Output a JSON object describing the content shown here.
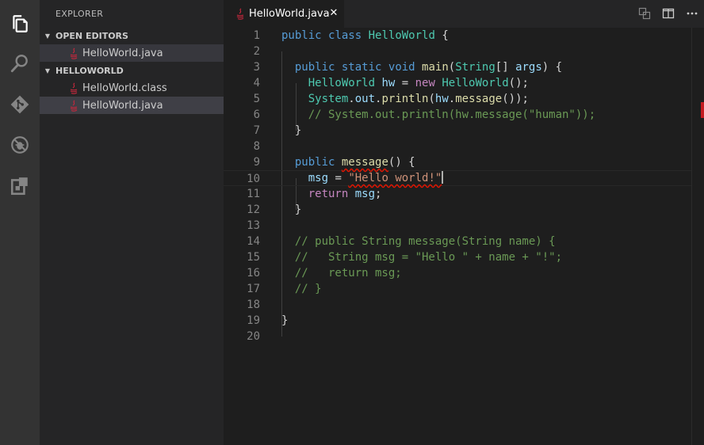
{
  "activity_bar": {
    "items": [
      {
        "name": "explorer-icon"
      },
      {
        "name": "search-icon"
      },
      {
        "name": "git-icon"
      },
      {
        "name": "debug-icon"
      },
      {
        "name": "extensions-icon"
      }
    ]
  },
  "sidebar": {
    "title": "EXPLORER",
    "open_editors": {
      "label": "OPEN EDITORS",
      "files": [
        "HelloWorld.java"
      ]
    },
    "project": {
      "label": "HELLOWORLD",
      "files": [
        "HelloWorld.class",
        "HelloWorld.java"
      ]
    }
  },
  "editor": {
    "tab": {
      "label": "HelloWorld.java",
      "close_glyph": "✕"
    },
    "actions": [
      "open-changes-icon",
      "split-editor-icon",
      "more-actions-icon"
    ],
    "line_numbers": [
      "1",
      "2",
      "3",
      "4",
      "5",
      "6",
      "7",
      "8",
      "9",
      "10",
      "11",
      "12",
      "13",
      "14",
      "15",
      "16",
      "17",
      "18",
      "19",
      "20"
    ],
    "code": {
      "l1": [
        "public",
        " ",
        "class",
        " ",
        "HelloWorld",
        " {"
      ],
      "l3": [
        "  ",
        "public",
        " ",
        "static",
        " ",
        "void",
        " ",
        "main",
        "(",
        "String",
        "[] ",
        "args",
        ") {"
      ],
      "l4": [
        "    ",
        "HelloWorld",
        " ",
        "hw",
        " = ",
        "new",
        " ",
        "HelloWorld",
        "();"
      ],
      "l5": [
        "    ",
        "System",
        ".",
        "out",
        ".",
        "println",
        "(",
        "hw",
        ".",
        "message",
        "());"
      ],
      "l6": [
        "    // System.out.println(hw.message(\"human\"));"
      ],
      "l7": [
        "  }"
      ],
      "l9": [
        "  ",
        "public",
        " ",
        "message",
        "() {"
      ],
      "l10": [
        "    ",
        "msg",
        " = ",
        "\"Hello world!\""
      ],
      "l11": [
        "    ",
        "return",
        " ",
        "msg",
        ";"
      ],
      "l12": [
        "  }"
      ],
      "l14": [
        "  // public String message(String name) {"
      ],
      "l15": [
        "  //   String msg = \"Hello \" + name + \"!\";"
      ],
      "l16": [
        "  //   return msg;"
      ],
      "l17": [
        "  // }"
      ],
      "l19": [
        "}"
      ]
    }
  },
  "colors": {
    "error": "#e51400",
    "java_icon": "#c5283d"
  }
}
